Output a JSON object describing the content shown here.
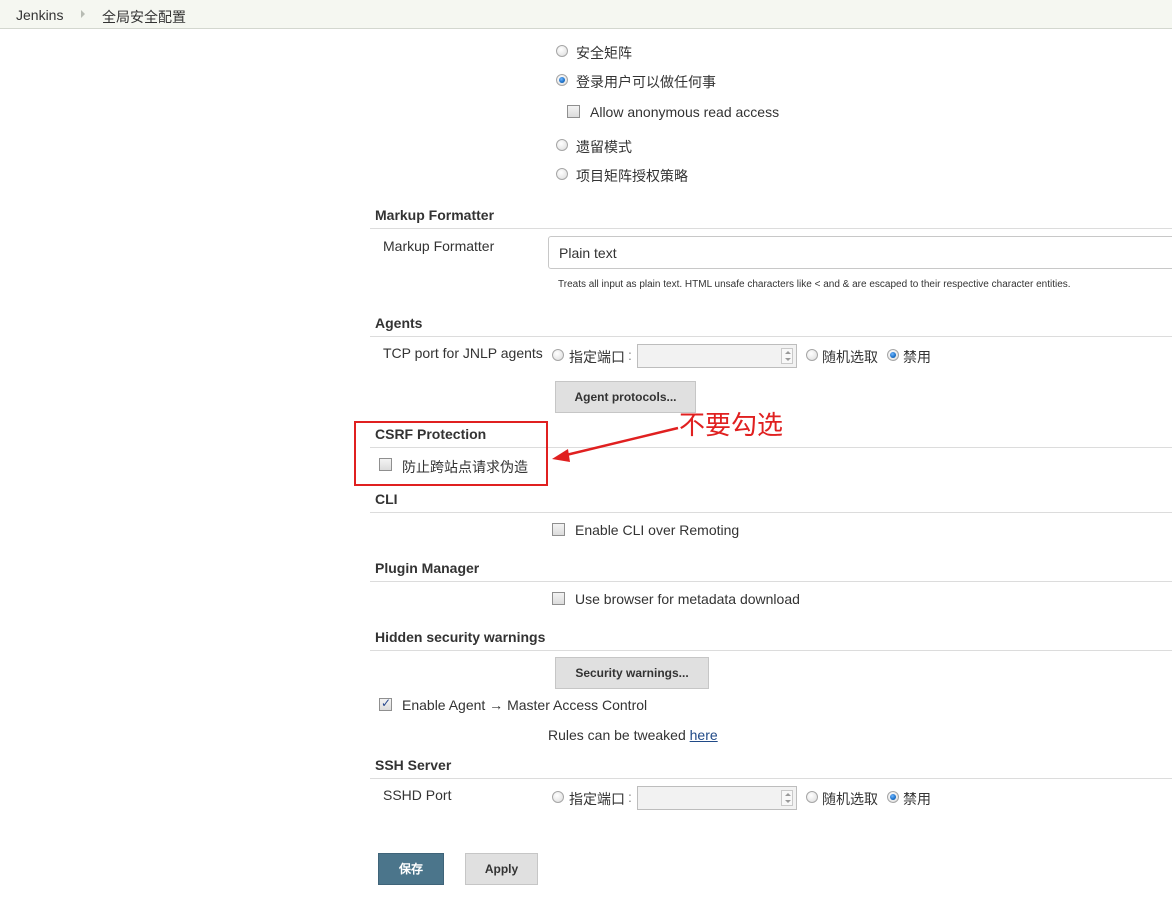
{
  "breadcrumb": {
    "items": [
      "Jenkins",
      "全局安全配置"
    ]
  },
  "authorization": {
    "options": [
      {
        "label": "安全矩阵",
        "checked": false
      },
      {
        "label": "登录用户可以做任何事",
        "checked": true
      },
      {
        "label": "遗留模式",
        "checked": false
      },
      {
        "label": "项目矩阵授权策略",
        "checked": false
      }
    ],
    "anonymous_read": {
      "label": "Allow anonymous read access",
      "checked": false
    }
  },
  "markup_formatter": {
    "title": "Markup Formatter",
    "field_label": "Markup Formatter",
    "selected": "Plain text",
    "help": "Treats all input as plain text. HTML unsafe characters like < and & are escaped to their respective character entities."
  },
  "agents": {
    "title": "Agents",
    "field_label": "TCP port for JNLP agents",
    "opt_fixed": "指定端口",
    "colon": ":",
    "opt_random": "随机选取",
    "opt_disable": "禁用",
    "selected": "禁用",
    "port_value": "",
    "protocols_button": "Agent protocols..."
  },
  "csrf": {
    "title": "CSRF Protection",
    "checkbox_label": "防止跨站点请求伪造",
    "checked": false
  },
  "annotation": {
    "text": "不要勾选",
    "color": "#e02020"
  },
  "cli": {
    "title": "CLI",
    "checkbox_label": "Enable CLI over Remoting",
    "checked": false
  },
  "plugin_manager": {
    "title": "Plugin Manager",
    "checkbox_label": "Use browser for metadata download",
    "checked": false
  },
  "hidden_warnings": {
    "title": "Hidden security warnings",
    "button": "Security warnings...",
    "agent_master_label": "Enable Agent → Master Access Control",
    "agent_master_checked": true,
    "rules_text": "Rules can be tweaked ",
    "rules_link": "here"
  },
  "ssh_server": {
    "title": "SSH Server",
    "field_label": "SSHD Port",
    "opt_fixed": "指定端口",
    "colon": ":",
    "opt_random": "随机选取",
    "opt_disable": "禁用",
    "selected": "禁用",
    "port_value": ""
  },
  "actions": {
    "save": "保存",
    "apply": "Apply",
    "save_color": "#4b758b"
  }
}
